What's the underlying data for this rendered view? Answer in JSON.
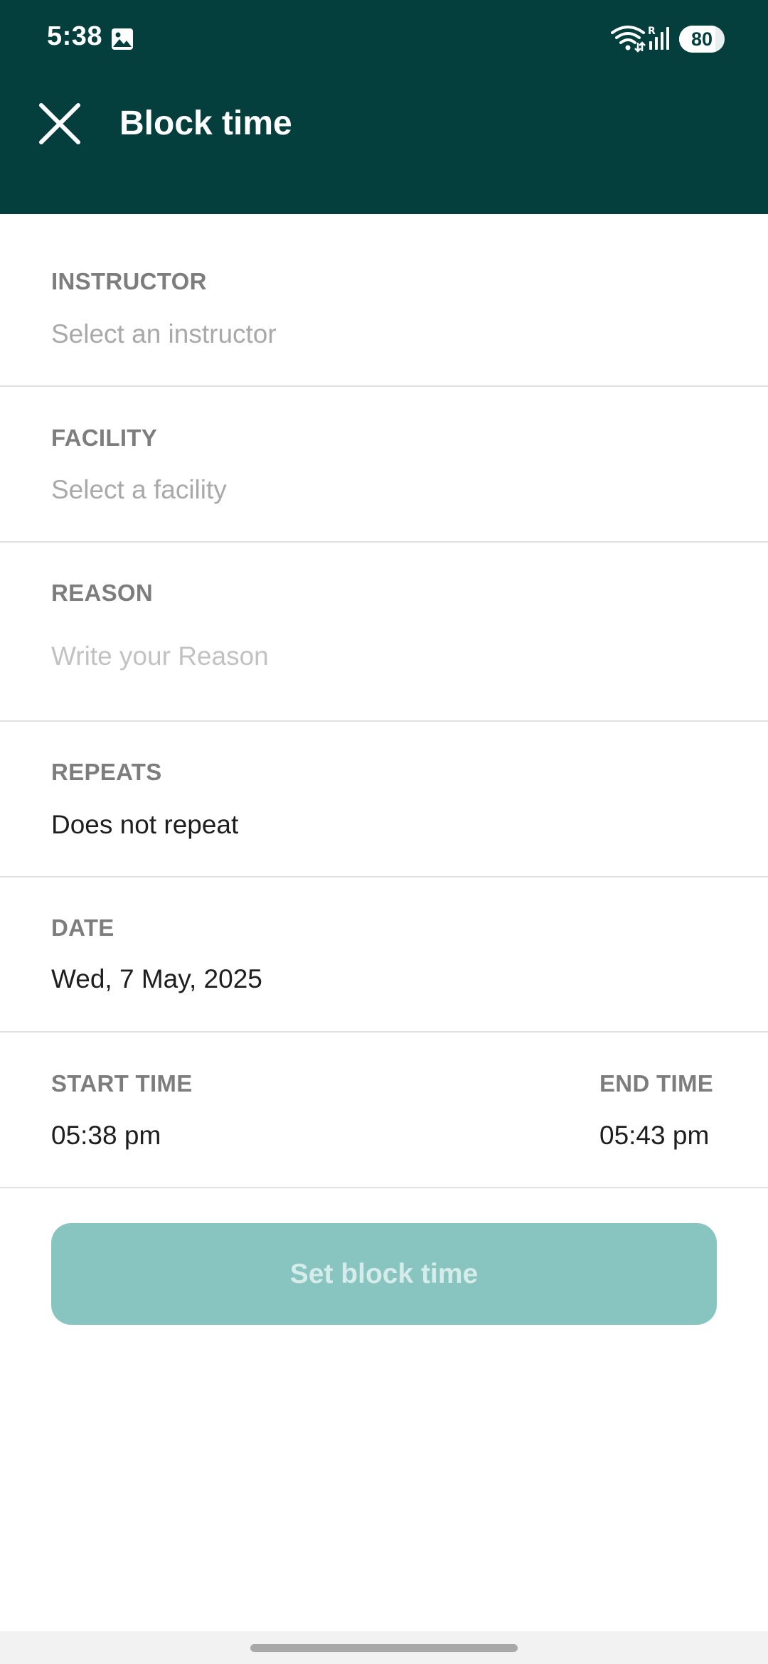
{
  "status_bar": {
    "time": "5:38",
    "battery_level": "80",
    "battery_fraction": 0.8,
    "icons": [
      "gallery-icon",
      "wifi-icon",
      "signal-icon",
      "battery-icon"
    ]
  },
  "header": {
    "title": "Block time",
    "close_icon": "close-icon",
    "background_color": "#043f3e"
  },
  "form": {
    "instructor": {
      "label": "INSTRUCTOR",
      "placeholder": "Select an instructor"
    },
    "facility": {
      "label": "FACILITY",
      "placeholder": "Select a facility"
    },
    "reason": {
      "label": "REASON",
      "placeholder": "Write your Reason",
      "value": ""
    },
    "repeats": {
      "label": "REPEATS",
      "value": "Does not repeat"
    },
    "date": {
      "label": "DATE",
      "value": "Wed, 7 May, 2025"
    },
    "start_time": {
      "label": "START TIME",
      "value": "05:38 pm"
    },
    "end_time": {
      "label": "END TIME",
      "value": "05:43 pm"
    }
  },
  "submit_button": {
    "label": "Set block time",
    "color": "#89c5c0"
  }
}
